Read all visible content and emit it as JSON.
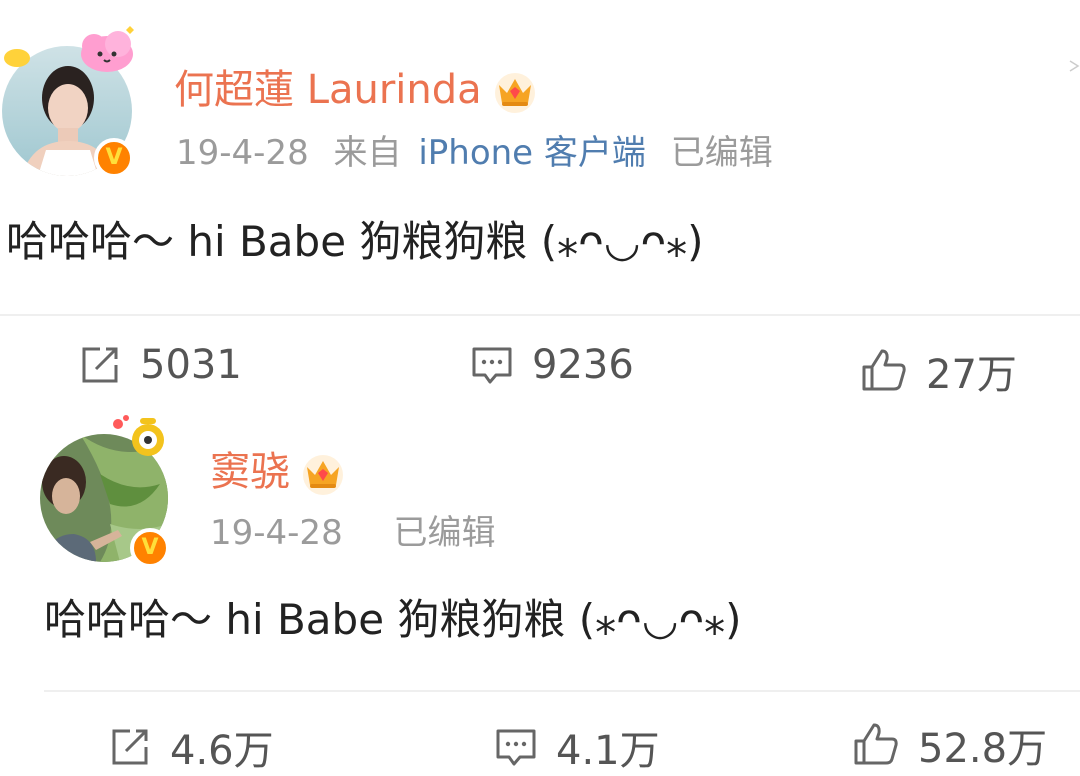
{
  "posts": [
    {
      "username": "何超蓮 Laurinda",
      "date": "19-4-28",
      "source_prefix": "来自",
      "source_name": "iPhone 客户端",
      "edited": "已编辑",
      "content": "哈哈哈～ hi Babe 狗粮狗粮 (⁎ᴖ◡ᴖ⁎)",
      "reposts": "5031",
      "comments": "9236",
      "likes": "27万"
    },
    {
      "username": "窦骁",
      "date": "19-4-28",
      "edited": "已编辑",
      "content": "哈哈哈～ hi Babe 狗粮狗粮 (⁎ᴖ◡ᴖ⁎)",
      "reposts": "4.6万",
      "comments": "4.1万",
      "likes": "52.8万"
    }
  ],
  "colors": {
    "username": "#eb7350",
    "link": "#507daf",
    "meta": "#9b9b9b",
    "verified_badge": "#ff8200"
  },
  "icons": {
    "repost": "repost-icon",
    "comment": "comment-icon",
    "like": "thumbs-up-icon",
    "crown": "crown-icon",
    "verified": "verified-v-icon"
  }
}
